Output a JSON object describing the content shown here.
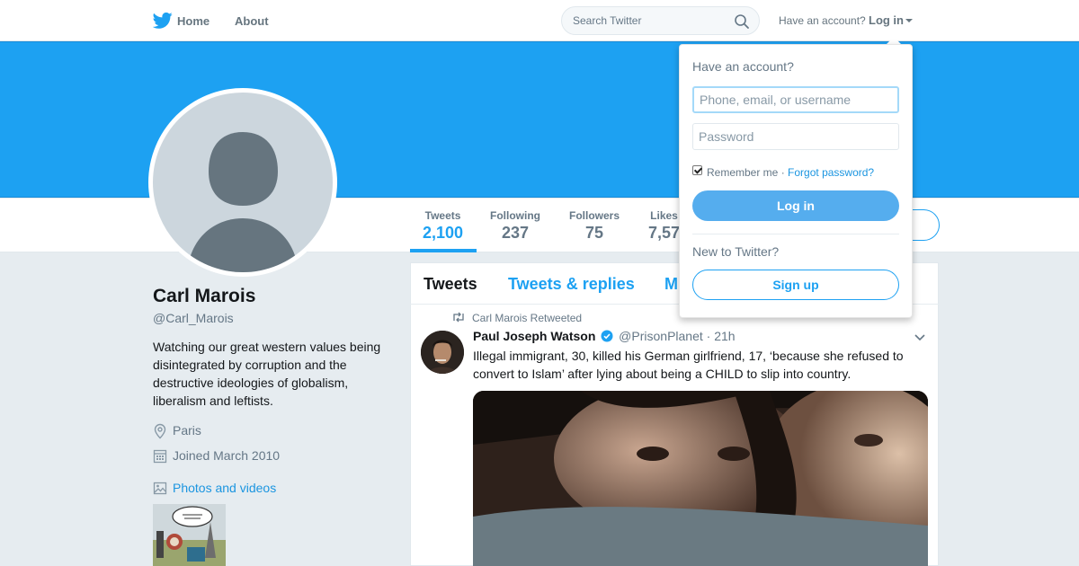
{
  "nav": {
    "home_label": "Home",
    "about_label": "About",
    "search_placeholder": "Search Twitter",
    "have_account_text": "Have an account?",
    "login_label": "Log in"
  },
  "profile": {
    "name": "Carl Marois",
    "handle": "@Carl_Marois",
    "bio": "Watching our great western values being disintegrated by corruption and the destructive ideologies of globalism, liberalism and leftists.",
    "location": "Paris",
    "joined": "Joined March 2010",
    "photos_link": "Photos and videos"
  },
  "stats": [
    {
      "label": "Tweets",
      "value": "2,100"
    },
    {
      "label": "Following",
      "value": "237"
    },
    {
      "label": "Followers",
      "value": "75"
    },
    {
      "label": "Likes",
      "value": "7,57"
    }
  ],
  "timeline": {
    "tabs": [
      "Tweets",
      "Tweets & replies",
      "M"
    ]
  },
  "tweet": {
    "retweet_context": "Carl Marois Retweeted",
    "fullname": "Paul Joseph Watson",
    "handle": "@PrisonPlanet",
    "separator": "·",
    "time": "21h",
    "text": "Illegal immigrant, 30, killed his German girlfriend, 17, ‘because she refused to convert to Islam’ after lying about being a CHILD to slip into country."
  },
  "login_dropdown": {
    "title": "Have an account?",
    "username_placeholder": "Phone, email, or username",
    "password_placeholder": "Password",
    "remember_label": "Remember me",
    "separator": "·",
    "forgot_label": "Forgot password?",
    "login_button": "Log in",
    "new_text": "New to Twitter?",
    "signup_button": "Sign up"
  },
  "colors": {
    "brand": "#1da1f2",
    "background": "#e6ecf0"
  },
  "icons": [
    "twitter-bird-icon",
    "search-icon",
    "location-icon",
    "calendar-icon",
    "photo-icon",
    "retweet-icon",
    "verified-icon",
    "chevron-down-icon"
  ]
}
